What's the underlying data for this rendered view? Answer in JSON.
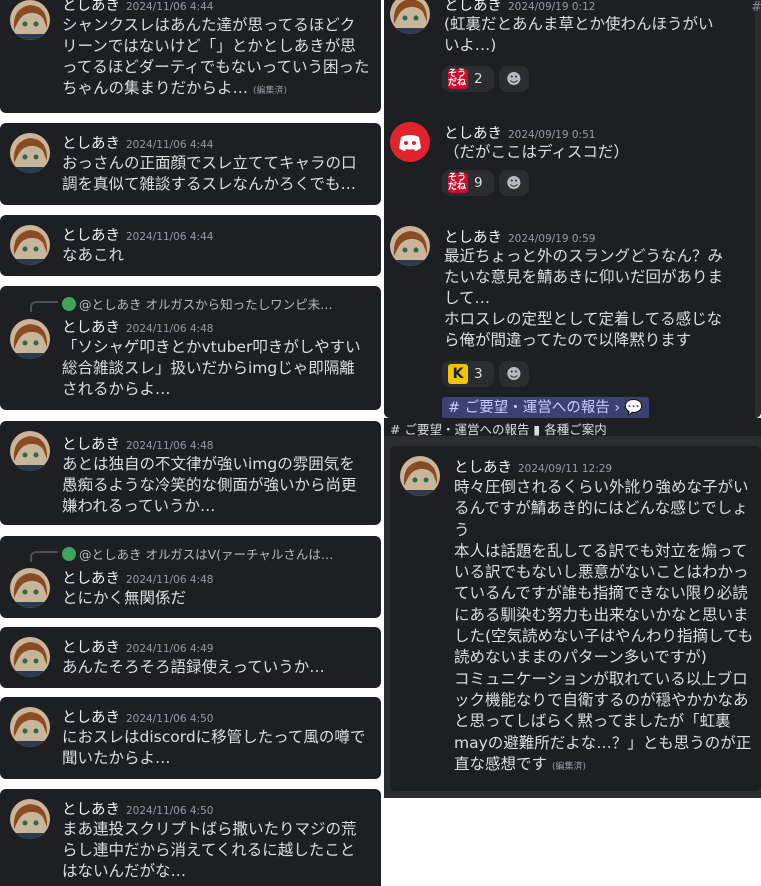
{
  "author": "としあき",
  "edited_label": "(編集済)",
  "left": [
    {
      "time": "2024/11/06 4:44",
      "body": "シャンクスレはあんた達が思ってるほどクリーンではないけど「」とかとしあきが思ってるほどダーティでもないっていう困ったちゃんの集まりだからよ…",
      "edited": true
    },
    {
      "time": "2024/11/06 4:44",
      "body": "おっさんの正面顔でスレ立ててキャラの口調を真似て雑談するスレなんかろくでも…"
    },
    {
      "time": "2024/11/06 4:44",
      "body": "なあこれ"
    },
    {
      "reply": "@としあき オルガスから知ったしワンピ未…",
      "time": "2024/11/06 4:48",
      "body": "「ソシャゲ叩きとかvtuber叩きがしやすい総合雑談スレ」扱いだからimgじゃ即隔離されるからよ…"
    },
    {
      "time": "2024/11/06 4:48",
      "body": "あとは独自の不文律が強いimgの雰囲気を愚痴るような冷笑的な側面が強いから尚更嫌われるっていうか…"
    },
    {
      "reply": "@としあき オルガスはV(ァーチャルさんは…",
      "time": "2024/11/06 4:48",
      "body": "とにかく無関係だ"
    },
    {
      "time": "2024/11/06 4:49",
      "body": "あんたそろそろ語録使えっていうか…"
    },
    {
      "time": "2024/11/06 4:50",
      "body": "におスレはdiscordに移管したって風の噂で聞いたからよ…"
    },
    {
      "time": "2024/11/06 4:50",
      "body": "まあ連投スクリプトばら撒いたりマジの荒らし連中だから消えてくれるに越したことはないんだがな…"
    }
  ],
  "right": [
    {
      "time": "2024/09/19 0:12",
      "body": "(虹裏だとあんま草とか使わんほうがいいよ…)",
      "reaction": {
        "emoji_text": "そう だね",
        "count": "2"
      }
    },
    {
      "time": "2024/09/19 0:51",
      "body": "（だがここはディスコだ）",
      "reaction": {
        "emoji_text": "そう だね",
        "count": "9"
      }
    },
    {
      "time": "2024/09/19 0:59",
      "body": "最近ちょっと外のスラングどうなん？みたいな意見を鯖あきに仰いだ回がありまして…\nホロスレの定型として定着してる感じなら俺が間違ってたので以降黙ります",
      "reaction": {
        "emoji_text": "K",
        "count": "3"
      },
      "channel_link": "# ご要望・運営への報告 ›"
    }
  ],
  "channel_strip": "# ご要望・運営への報告 ▮ 各種ご案内",
  "right_bottom": {
    "time": "2024/09/11 12:29",
    "body": "時々圧倒されるくらい外訛り強めな子がいるんですが鯖あき的にはどんな感じでしょう\n本人は話題を乱してる訳でも対立を煽っている訳でもないし悪意がないことはわかっているんですが誰も指摘できない限り必読にある馴染む努力も出来ないかなと思いました(空気読めない子はやんわり指摘しても読めないままのパターン多いですが)\nコミュニケーションが取れている以上ブロック機能なりで自衛するのが穏やかかなあと思ってしばらく黙ってましたが「虹裏mayの避難所だよな…？」とも思うのが正直な感想です",
    "edited": true
  },
  "colors": {
    "card_bg": "#1e1f22",
    "discord_red": "#ed4245",
    "mention_bg": "#3c4270"
  }
}
